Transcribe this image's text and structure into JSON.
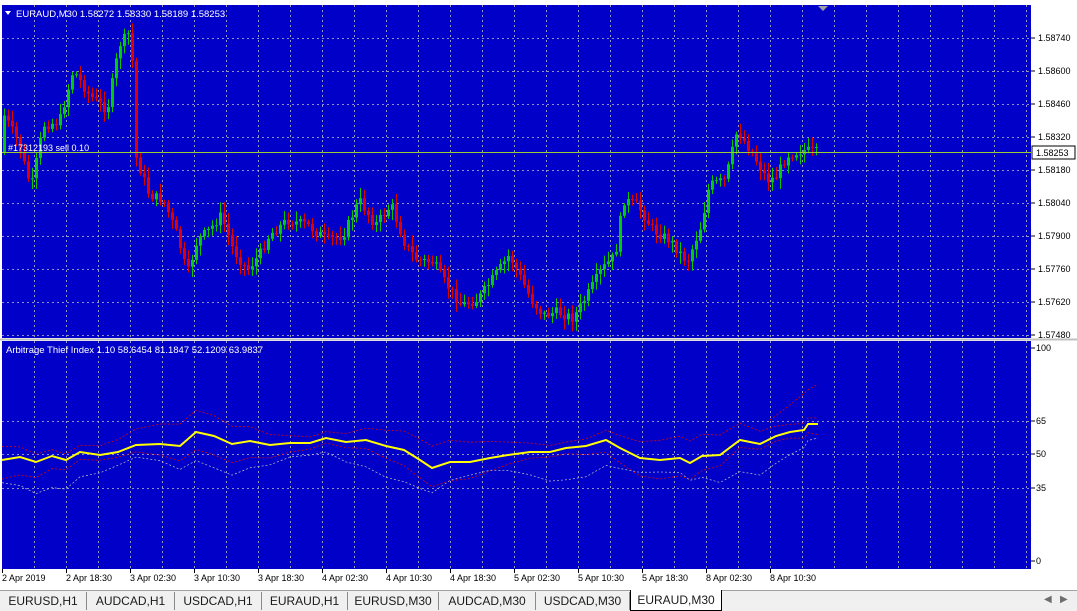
{
  "main_chart": {
    "symbol_header": "EURAUD,M30  1.58272 1.58330 1.58189 1.58253",
    "collapse_icon": "triangle-down-icon",
    "order_line_label": "#17312193 sell 0.10",
    "price_axis_labels": [
      "1.58740",
      "1.58600",
      "1.58460",
      "1.58320",
      "1.58180",
      "1.58040",
      "1.57900",
      "1.57760",
      "1.57620",
      "1.57480"
    ],
    "current_price": "1.58253",
    "colors": {
      "background": "#0000C8",
      "grid": "#C0C0C0",
      "bull_candle": "#00CC00",
      "bear_candle": "#E00000",
      "order_line": "#9ACD32",
      "axis_bg": "#ffffff",
      "axis_text": "#000000"
    }
  },
  "indicator": {
    "header": "Arbitrage Thief Index 1.10 58.6454 81.1847 52.1209 63.9837",
    "level_labels": [
      "100",
      "65",
      "50",
      "35",
      "0"
    ],
    "colors": {
      "main_line": "#FFFF00",
      "upper_line": "#E00000",
      "lower_line": "#E00000",
      "band_line": "#C0C0C0"
    }
  },
  "time_axis_labels": [
    "2 Apr 2019",
    "2 Apr 18:30",
    "3 Apr 02:30",
    "3 Apr 10:30",
    "3 Apr 18:30",
    "4 Apr 02:30",
    "4 Apr 10:30",
    "4 Apr 18:30",
    "5 Apr 02:30",
    "5 Apr 10:30",
    "5 Apr 18:30",
    "8 Apr 02:30",
    "8 Apr 10:30"
  ],
  "tabs": [
    {
      "label": "EURUSD,H1"
    },
    {
      "label": "AUDCAD,H1"
    },
    {
      "label": "USDCAD,H1"
    },
    {
      "label": "EURAUD,H1"
    },
    {
      "label": "EURUSD,M30"
    },
    {
      "label": "AUDCAD,M30"
    },
    {
      "label": "USDCAD,M30"
    },
    {
      "label": "EURAUD,M30"
    }
  ],
  "active_tab": "EURAUD,M30",
  "tab_scroll": {
    "left_icon": "arrow-left-icon",
    "right_icon": "arrow-right-icon",
    "left_glyph": "◀",
    "right_glyph": "▶"
  }
}
